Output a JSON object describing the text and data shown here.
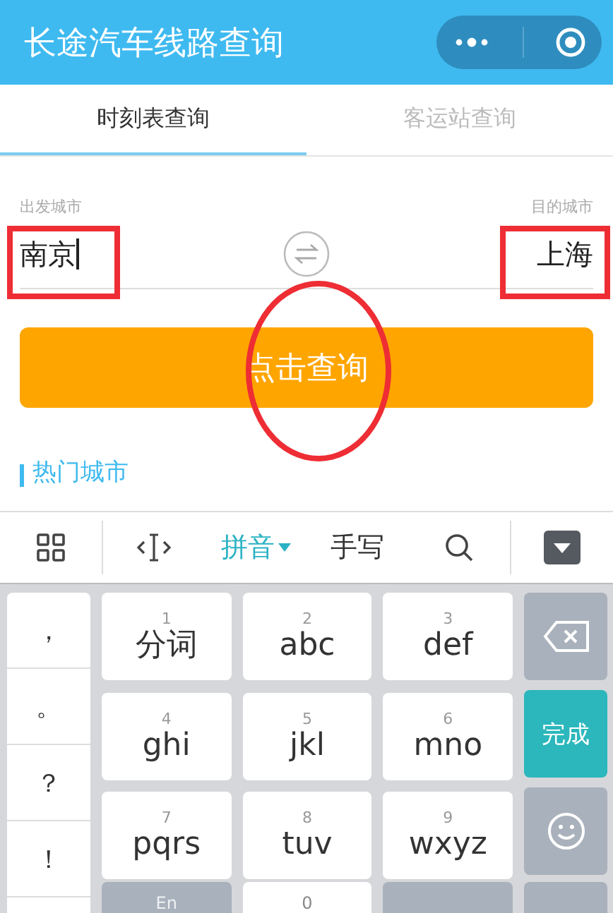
{
  "window": {
    "title": "长途汽车线路查询"
  },
  "tabs": [
    {
      "label": "时刻表查询",
      "selected": true
    },
    {
      "label": "客运站查询",
      "selected": false
    }
  ],
  "from_city": {
    "label": "出发城市",
    "value": "南京",
    "highlighted": true
  },
  "to_city": {
    "label": "目的城市",
    "value": "上海",
    "highlighted": true
  },
  "search_button": {
    "label": "点击查询",
    "circled": true
  },
  "hot_cities": {
    "heading": "热门城市"
  },
  "keyboard": {
    "toolbar": [
      {
        "kind": "grid"
      },
      {
        "kind": "cursor"
      },
      {
        "kind": "mode",
        "label": "拼音",
        "selected": true
      },
      {
        "kind": "mode",
        "label": "手写",
        "selected": false
      },
      {
        "kind": "search"
      },
      {
        "kind": "hide"
      }
    ],
    "punctuation": [
      "，",
      "。",
      "？",
      "！"
    ],
    "keys": [
      {
        "digit": "1",
        "label": "分词"
      },
      {
        "digit": "2",
        "label": "abc"
      },
      {
        "digit": "3",
        "label": "def"
      },
      {
        "digit": "4",
        "label": "ghi"
      },
      {
        "digit": "5",
        "label": "jkl"
      },
      {
        "digit": "6",
        "label": "mno"
      },
      {
        "digit": "7",
        "label": "pqrs"
      },
      {
        "digit": "8",
        "label": "tuv"
      },
      {
        "digit": "9",
        "label": "wxyz"
      }
    ],
    "side_keys": [
      {
        "kind": "backspace"
      },
      {
        "kind": "done",
        "label": "完成"
      },
      {
        "kind": "emoji"
      }
    ],
    "bottom_keys": [
      {
        "kind": "grey",
        "label": "En"
      },
      {
        "kind": "white",
        "label": "0"
      },
      {
        "kind": "grey"
      },
      {
        "kind": "grey"
      }
    ]
  }
}
